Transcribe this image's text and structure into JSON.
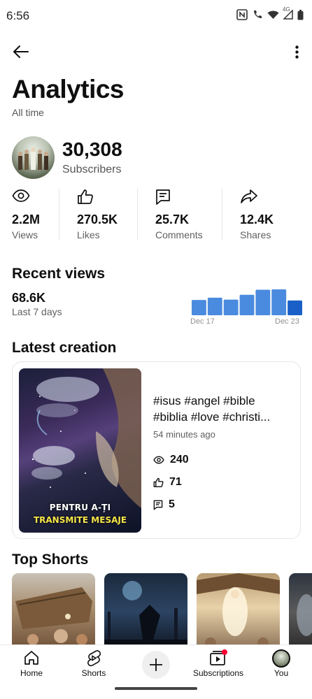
{
  "status": {
    "time": "6:56",
    "network": "4G"
  },
  "header": {
    "back_icon": "arrow-left-icon",
    "more_icon": "more-vert-icon"
  },
  "page": {
    "title": "Analytics",
    "range": "All time"
  },
  "channel": {
    "subscribers": "30,308",
    "subscribers_label": "Subscribers"
  },
  "stats": [
    {
      "icon": "eye-icon",
      "value": "2.2M",
      "label": "Views"
    },
    {
      "icon": "thumb-up-icon",
      "value": "270.5K",
      "label": "Likes"
    },
    {
      "icon": "comment-icon",
      "value": "25.7K",
      "label": "Comments"
    },
    {
      "icon": "share-icon",
      "value": "12.4K",
      "label": "Shares"
    }
  ],
  "recent_views": {
    "title": "Recent views",
    "value": "68.6K",
    "label": "Last 7 days",
    "tick_start": "Dec 17",
    "tick_end": "Dec 23"
  },
  "chart_data": {
    "type": "bar",
    "categories": [
      "Dec 17",
      "Dec 18",
      "Dec 19",
      "Dec 20",
      "Dec 21",
      "Dec 22",
      "Dec 23"
    ],
    "values": [
      9.0,
      10.3,
      9.2,
      12.0,
      15.0,
      15.2,
      8.7
    ],
    "colors": {
      "bar": "#4a8bdf",
      "current_bar": "#1a5fc8"
    }
  },
  "latest_creation": {
    "title": "Latest creation",
    "thumbnail_caption_1": "PENTRU A-ȚI",
    "thumbnail_caption_2": "TRANSMITE MESAJE",
    "video_title_line1": "#isus #angel #bible",
    "video_title_line2": "#biblia #love #christi...",
    "published": "54 minutes ago",
    "views": "240",
    "likes": "71",
    "comments": "5"
  },
  "top_shorts": {
    "title": "Top Shorts"
  },
  "nav": {
    "home": "Home",
    "shorts": "Shorts",
    "subscriptions": "Subscriptions",
    "you": "You"
  },
  "colors": {
    "accent": "#1a5fc8",
    "notification_dot": "#ff0033"
  }
}
